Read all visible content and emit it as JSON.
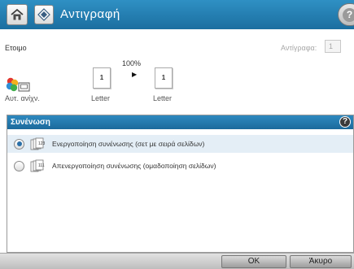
{
  "header": {
    "title": "Αντιγραφή",
    "home_icon": "home-icon",
    "app_icon": "copy-app-icon",
    "help_icon": "help-icon",
    "help_glyph": "?"
  },
  "status": {
    "text": "Ετοιμο",
    "copies_label": "Αντίγραφα:",
    "copies_value": "1"
  },
  "copy_settings": {
    "zoom": "100%",
    "arrow": "▶",
    "source_page_number": "1",
    "output_page_number": "1",
    "source_size": "Letter",
    "output_size": "Letter",
    "auto_detect_label": "Αυτ. ανίχν."
  },
  "panel": {
    "title": "Συνένωση",
    "help_glyph": "?",
    "options": [
      {
        "label": "Ενεργοποίηση συνένωσης (σετ με σειρά σελίδων)",
        "selected": true
      },
      {
        "label": "Απενεργοποίηση συνένωσης (ομαδοποίηση σελίδων)",
        "selected": false
      }
    ]
  },
  "footer": {
    "ok_label": "OK",
    "cancel_label": "Άκυρο"
  },
  "colors": {
    "header_blue": "#1b6ea0",
    "selected_row": "#e4eef6"
  }
}
